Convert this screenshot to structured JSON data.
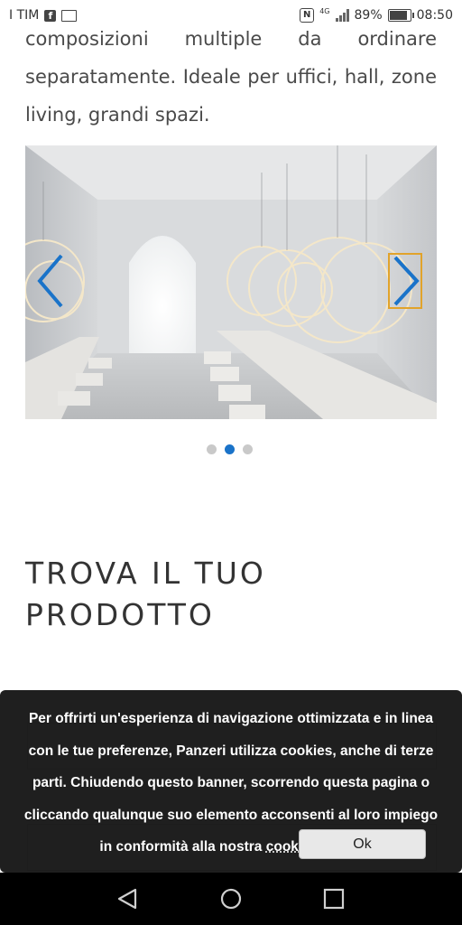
{
  "status_bar": {
    "carrier": "I TIM",
    "network_type": "4G",
    "battery": "89%",
    "time": "08:50"
  },
  "description": {
    "text": "composizioni multiple da ordinare separatamente. Ideale per uffici, hall, zone living, grandi spazi."
  },
  "carousel": {
    "slide_count": 3,
    "active_index": 1
  },
  "section": {
    "title_line1": "TROVA IL TUO",
    "title_line2": "PRODOTTO"
  },
  "cookie_banner": {
    "text_before_link": "Per offrirti un'esperienza di navigazione ottimizzata e in linea con le tue preferenze, Panzeri utilizza cookies, anche di terze parti. Chiudendo questo banner, scorrendo questa pagina o cliccando qualunque suo elemento acconsenti al loro impiego in conformità alla nostra",
    "link_label": "cookies policy",
    "ok_label": "Ok"
  },
  "colors": {
    "accent": "#1a73c9",
    "focus_outline": "#e1a32b"
  }
}
